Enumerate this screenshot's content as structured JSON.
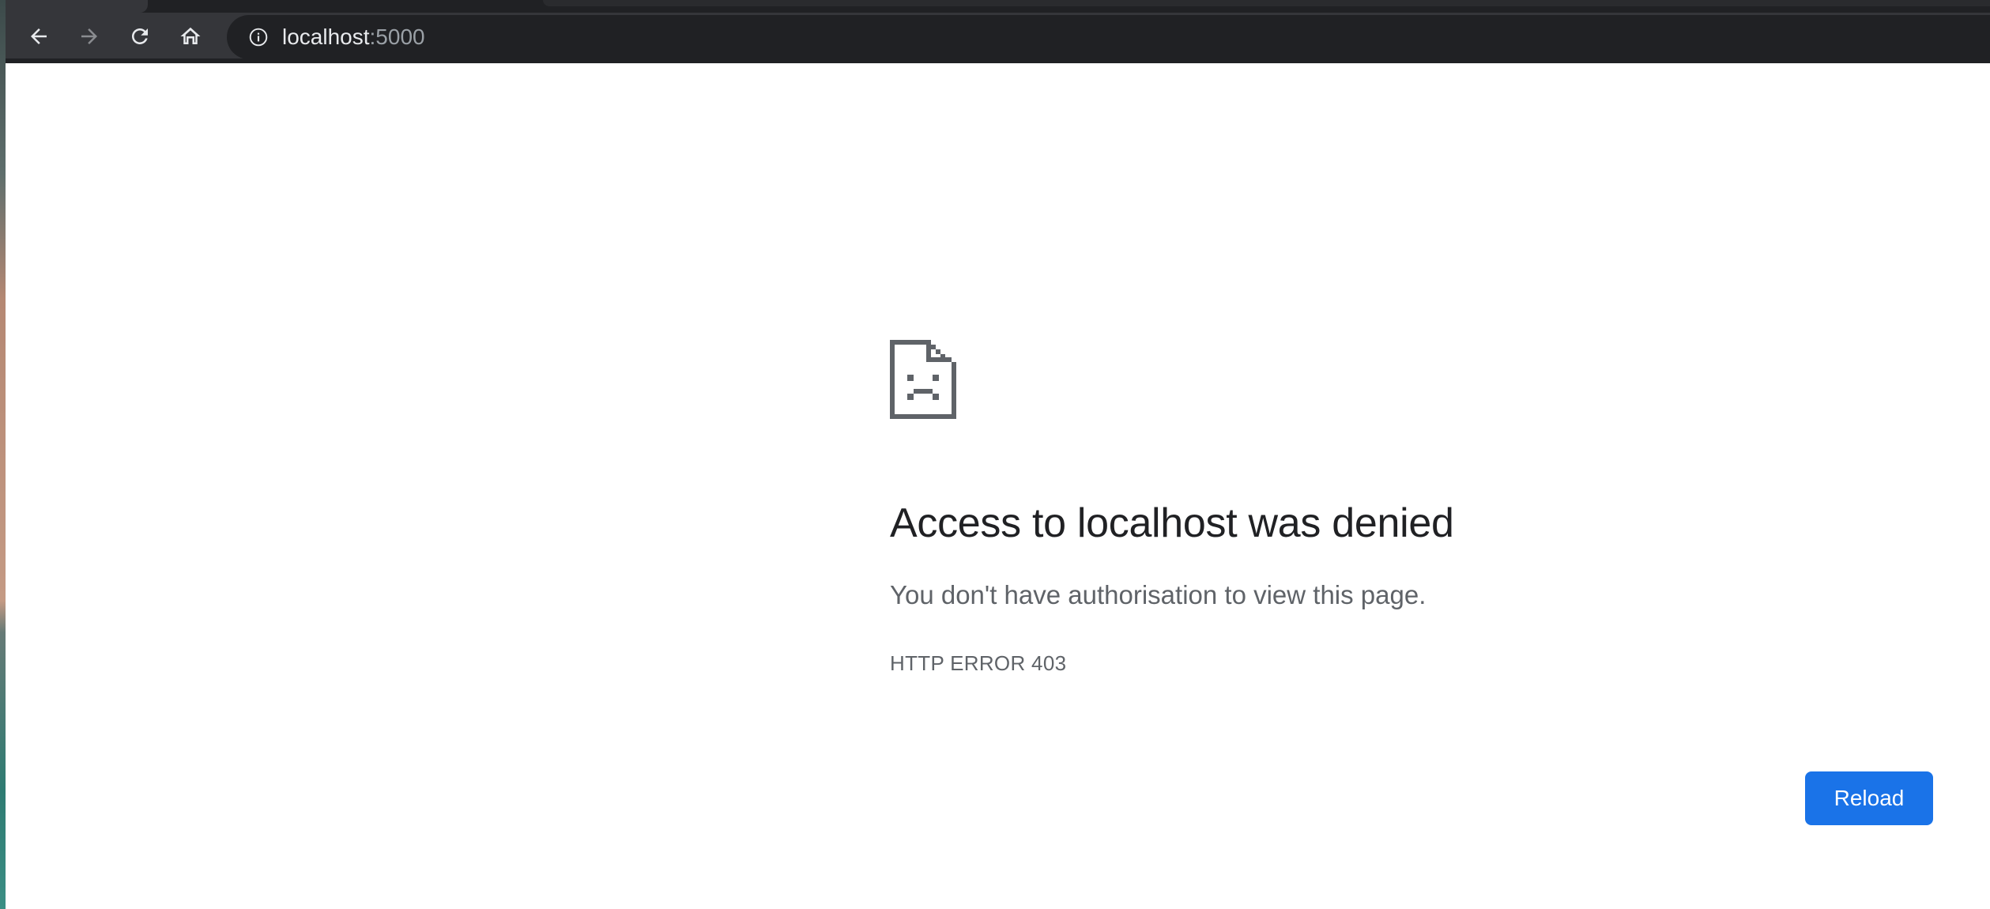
{
  "browser": {
    "address_bar": {
      "host": "localhost",
      "port": ":5000"
    },
    "icons": {
      "back": "arrow-left-icon",
      "forward": "arrow-right-icon",
      "reload": "reload-icon",
      "home": "home-icon",
      "site_info": "info-icon"
    }
  },
  "error_page": {
    "icon": "sad-document-icon",
    "title": "Access to localhost was denied",
    "description": "You don't have authorisation to view this page.",
    "code": "HTTP ERROR 403",
    "reload_label": "Reload"
  },
  "colors": {
    "toolbar": "#35363a",
    "omnibox": "#202124",
    "primary_button": "#1a73e8",
    "title_text": "#202124",
    "secondary_text": "#5f6368"
  }
}
